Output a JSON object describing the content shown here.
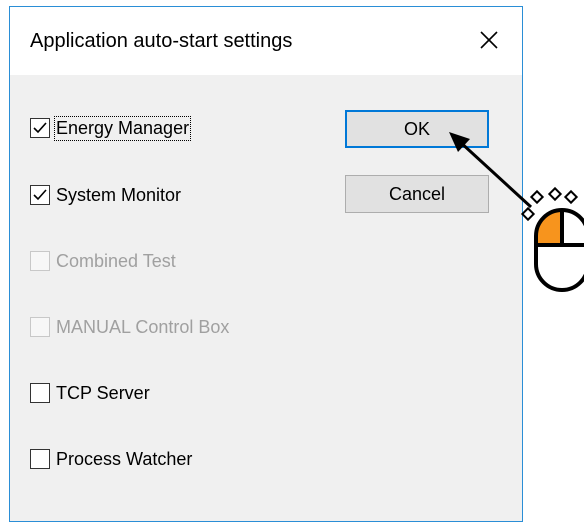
{
  "dialog": {
    "title": "Application auto-start settings",
    "close_icon": "close-icon"
  },
  "checkboxes": [
    {
      "label": "Energy Manager",
      "checked": true,
      "enabled": true,
      "focused": true
    },
    {
      "label": "System Monitor",
      "checked": true,
      "enabled": true,
      "focused": false
    },
    {
      "label": "Combined Test",
      "checked": false,
      "enabled": false,
      "focused": false
    },
    {
      "label": "MANUAL Control Box",
      "checked": false,
      "enabled": false,
      "focused": false
    },
    {
      "label": "TCP Server",
      "checked": false,
      "enabled": true,
      "focused": false
    },
    {
      "label": "Process Watcher",
      "checked": false,
      "enabled": true,
      "focused": false
    }
  ],
  "buttons": {
    "ok_label": "OK",
    "cancel_label": "Cancel"
  },
  "annotation": {
    "pointer_icon": "mouse-left-click-icon",
    "arrow_icon": "arrow-icon",
    "accent_color": "#f7941d"
  },
  "colors": {
    "title_border": "#2a8ed6",
    "client_bg": "#f0f0f0",
    "default_button_border": "#0078d7"
  }
}
